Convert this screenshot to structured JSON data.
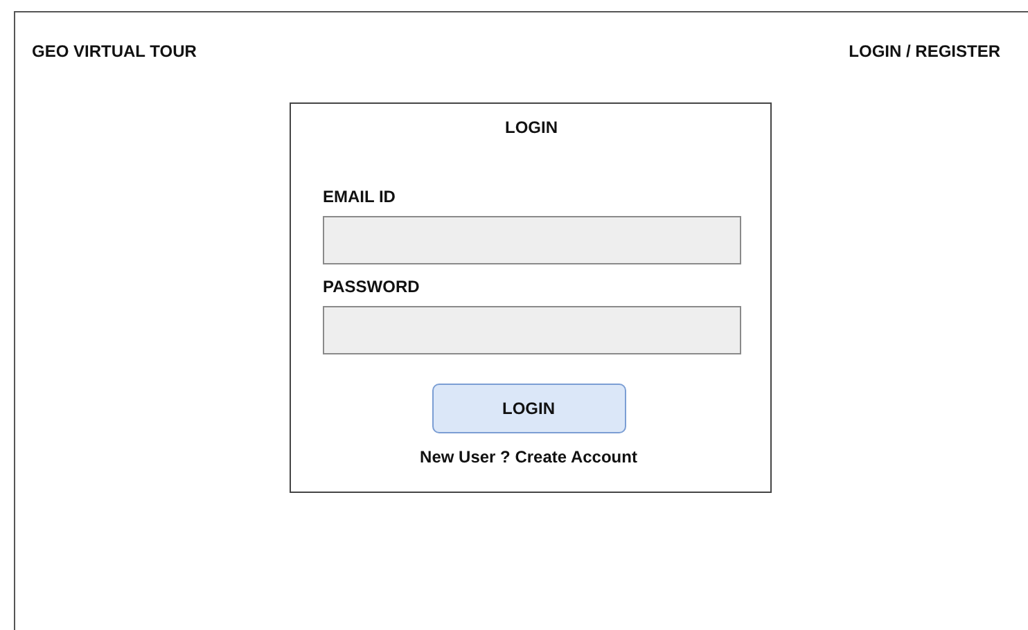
{
  "header": {
    "brand": "GEO VIRTUAL TOUR",
    "nav_link": "LOGIN / REGISTER"
  },
  "login_card": {
    "title": "LOGIN",
    "fields": [
      {
        "label": "EMAIL ID"
      },
      {
        "label": "PASSWORD"
      }
    ],
    "button": "LOGIN",
    "footer_link": "New User ? Create Account"
  }
}
